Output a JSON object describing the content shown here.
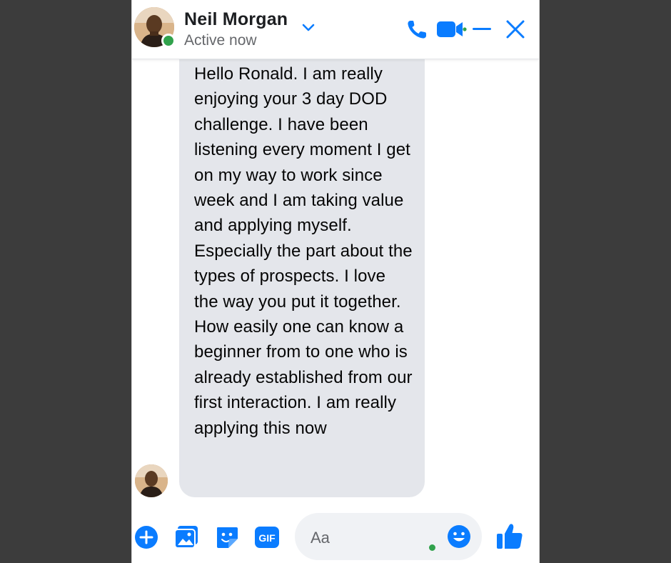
{
  "contact": {
    "name": "Neil Morgan",
    "status": "Active now"
  },
  "message": {
    "text": "Hello Ronald. I am really enjoying your 3 day DOD challenge. I have been listening every moment I get on my way to work since week and I am taking value and applying myself. Especially the part about the types of prospects. I love the way you put it together. How easily one can know a beginner from to one who is already established from our first interaction. I am really applying this now"
  },
  "composer": {
    "placeholder": "Aa"
  },
  "colors": {
    "accent": "#0a7cff",
    "online": "#31a24c",
    "bubble": "#e4e6eb",
    "backdrop": "#3c3c3c"
  },
  "icons": {
    "header": [
      "chevron-down-icon",
      "phone-icon",
      "video-camera-icon",
      "minimize-icon",
      "close-icon"
    ],
    "composer": [
      "plus-circle-icon",
      "photo-icon",
      "sticker-icon",
      "gif-icon",
      "emoji-icon",
      "thumbs-up-icon"
    ]
  }
}
